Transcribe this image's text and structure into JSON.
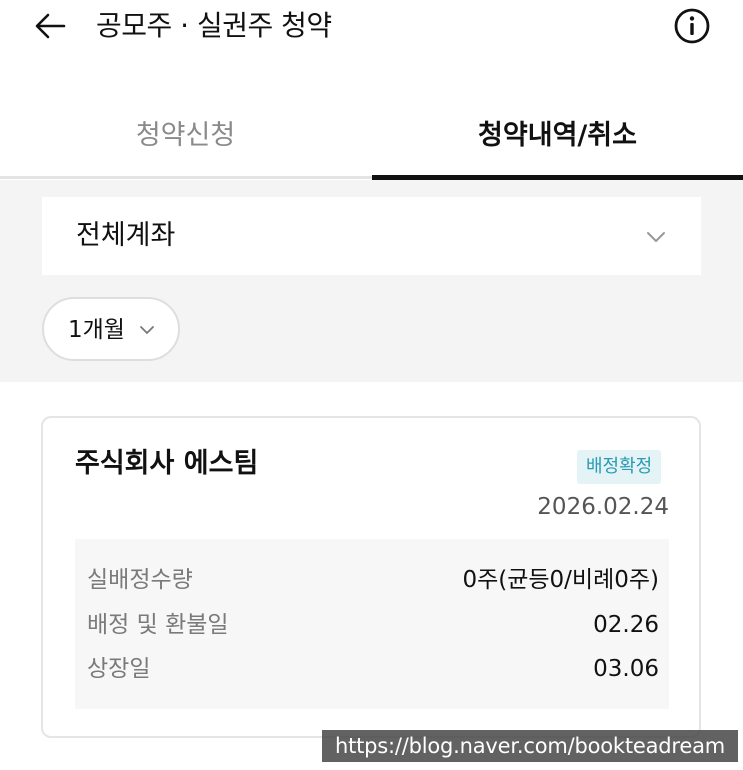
{
  "header": {
    "title": "공모주 · 실권주 청약",
    "back_icon": "arrow-left-icon",
    "info_icon": "info-circle-icon"
  },
  "tabs": [
    {
      "label": "청약신청",
      "active": false
    },
    {
      "label": "청약내역/취소",
      "active": true
    }
  ],
  "filters": {
    "account": "전체계좌",
    "period": "1개월"
  },
  "card": {
    "company": "주식회사 에스팀",
    "badge": "배정확정",
    "date": "2026.02.24",
    "details": [
      {
        "label": "실배정수량",
        "value": "0주(균등0/비례0주)"
      },
      {
        "label": "배정 및 환불일",
        "value": "02.26"
      },
      {
        "label": "상장일",
        "value": "03.06"
      }
    ]
  },
  "watermark": "https://blog.naver.com/bookteadream",
  "colors": {
    "badge_bg": "#e3f3f6",
    "badge_text": "#2a9bb3",
    "filter_bg": "#f4f4f4",
    "active_tab": "#111111",
    "inactive_tab": "#8a8a8a"
  }
}
